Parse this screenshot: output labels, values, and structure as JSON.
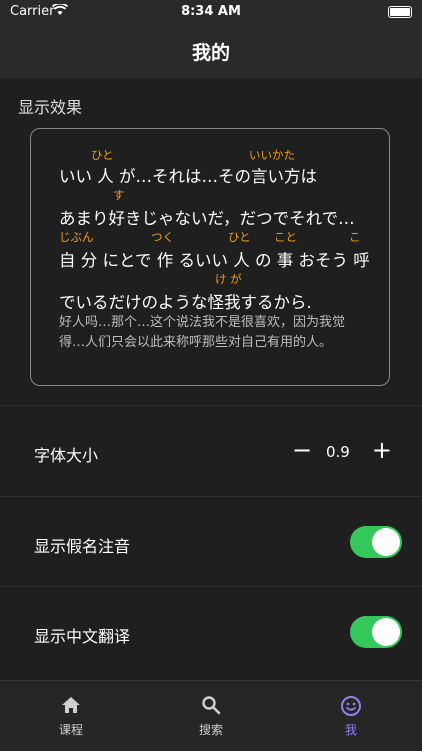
{
  "status": {
    "carrier": "Carrier",
    "time": "8:34 AM"
  },
  "nav": {
    "title": "我的"
  },
  "section": {
    "label": "显示效果"
  },
  "preview": {
    "lines": [
      "いい 人 が…それは…その言い方は",
      "あまり好きじゃないだ，だつでそれで…",
      "自 分 にとで 作 るいい 人 の 事 おそう 呼",
      "でいるだけのような怪我するから."
    ],
    "ruby": [
      "ひと",
      "いいかた",
      "す",
      "じぶん",
      "つく",
      "ひと",
      "こと",
      "こ",
      "け が"
    ],
    "translation": "好人吗…那个…这个说法我不是很喜欢，因为我觉得…人们只会以此来称呼那些对自己有用的人。"
  },
  "settings": {
    "font_size_label": "字体大小",
    "font_size_value": "0.9",
    "minus": "−",
    "plus": "+",
    "kana_label": "显示假名注音",
    "kana_on": true,
    "translation_label": "显示中文翻译",
    "translation_on": true
  },
  "tabs": [
    {
      "label": "课程",
      "icon": "home-icon"
    },
    {
      "label": "搜索",
      "icon": "search-icon"
    },
    {
      "label": "我",
      "icon": "smiley-icon",
      "active": true
    }
  ],
  "colors": {
    "accent": "#9a7cf2",
    "toggle_on": "#34c759",
    "ruby": "#f39c1a"
  }
}
